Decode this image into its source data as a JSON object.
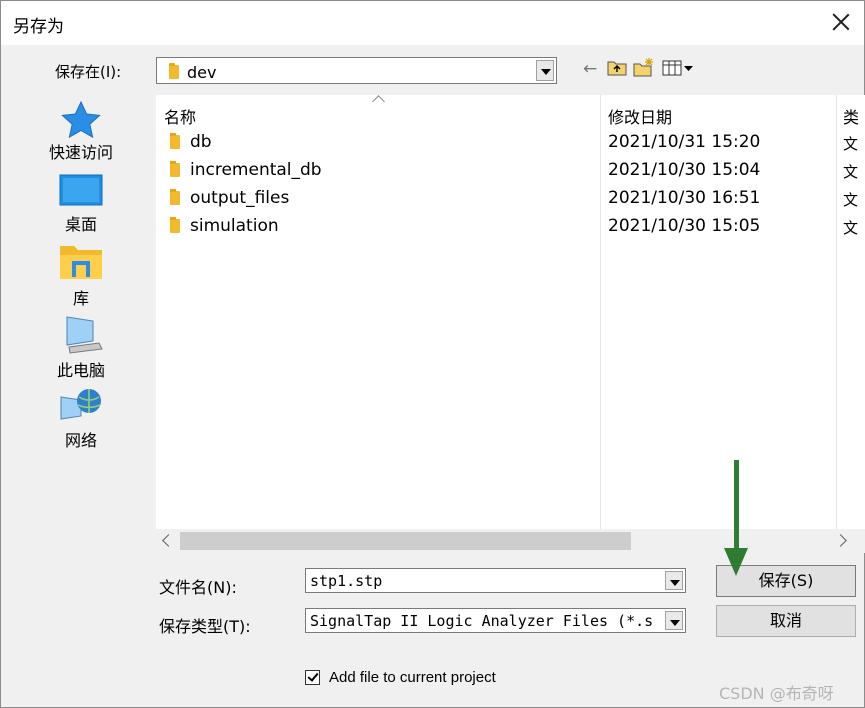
{
  "window": {
    "title": "另存为"
  },
  "lookin": {
    "label": "保存在(I):",
    "value": "dev"
  },
  "toolbar": {
    "back_glyph": "←",
    "up_glyph": "⇧",
    "newfolder_glyph": "✱",
    "view_glyph": "▦▾"
  },
  "places": [
    {
      "label": "快速访问",
      "icon": "star-icon"
    },
    {
      "label": "桌面",
      "icon": "desktop-icon"
    },
    {
      "label": "库",
      "icon": "library-icon"
    },
    {
      "label": "此电脑",
      "icon": "computer-icon"
    },
    {
      "label": "网络",
      "icon": "network-icon"
    }
  ],
  "columns": {
    "name": "名称",
    "date": "修改日期",
    "type": "类"
  },
  "files": [
    {
      "name": "db",
      "date": "2021/10/31 15:20",
      "type": "文"
    },
    {
      "name": "incremental_db",
      "date": "2021/10/30 15:04",
      "type": "文"
    },
    {
      "name": "output_files",
      "date": "2021/10/30 16:51",
      "type": "文"
    },
    {
      "name": "simulation",
      "date": "2021/10/30 15:05",
      "type": "文"
    }
  ],
  "filename": {
    "label": "文件名(N):",
    "value": "stp1.stp"
  },
  "filetype": {
    "label": "保存类型(T):",
    "value": "SignalTap II Logic Analyzer Files (*.s"
  },
  "buttons": {
    "save": "保存(S)",
    "cancel": "取消"
  },
  "checkbox": {
    "label": "Add file to current project",
    "checked": true
  },
  "watermark": "CSDN @布奇呀",
  "colors": {
    "accent_arrow": "#2e7d32",
    "folder": "#f3b92c"
  }
}
